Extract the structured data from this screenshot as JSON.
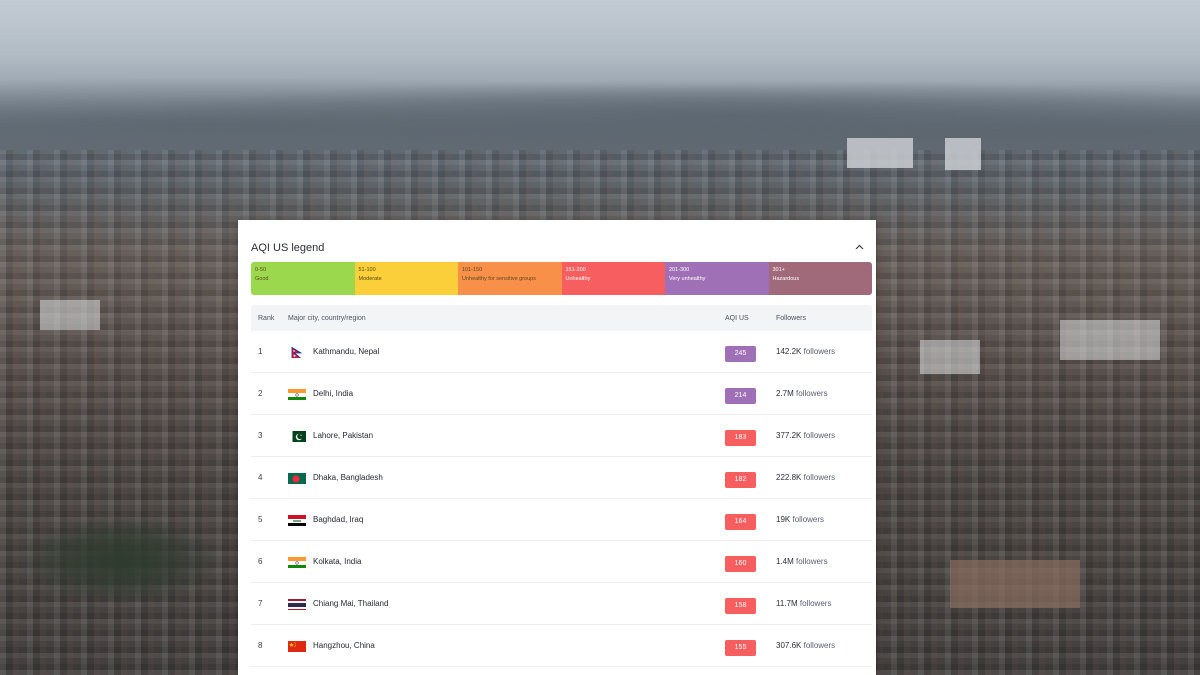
{
  "panel": {
    "title": "AQI US legend",
    "legend": [
      {
        "range": "0-50",
        "label": "Good",
        "color": "#9cd84e"
      },
      {
        "range": "51-100",
        "label": "Moderate",
        "color": "#facf39"
      },
      {
        "range": "101-150",
        "label": "Unhealthy for sensitive groups",
        "color": "#f99049"
      },
      {
        "range": "151-200",
        "label": "Unhealthy",
        "color": "#f65e5f"
      },
      {
        "range": "201-300",
        "label": "Very unhealthy",
        "color": "#a070b6"
      },
      {
        "range": "301+",
        "label": "Hazardous",
        "color": "#a06a7b"
      }
    ]
  },
  "table": {
    "headers": {
      "rank": "Rank",
      "city": "Major city, country/region",
      "aqi": "AQI US",
      "followers": "Followers"
    },
    "rows": [
      {
        "rank": "1",
        "city": "Kathmandu, Nepal",
        "flag": "nepal-flag",
        "aqi": "245",
        "aqi_color": "#a070b6",
        "followers": "142.2K",
        "followers_suffix": "followers"
      },
      {
        "rank": "2",
        "city": "Delhi, India",
        "flag": "india-flag",
        "aqi": "214",
        "aqi_color": "#a070b6",
        "followers": "2.7M",
        "followers_suffix": "followers"
      },
      {
        "rank": "3",
        "city": "Lahore, Pakistan",
        "flag": "pakistan-flag",
        "aqi": "183",
        "aqi_color": "#f65e5f",
        "followers": "377.2K",
        "followers_suffix": "followers"
      },
      {
        "rank": "4",
        "city": "Dhaka, Bangladesh",
        "flag": "bangladesh-flag",
        "aqi": "182",
        "aqi_color": "#f65e5f",
        "followers": "222.8K",
        "followers_suffix": "followers"
      },
      {
        "rank": "5",
        "city": "Baghdad, Iraq",
        "flag": "iraq-flag",
        "aqi": "164",
        "aqi_color": "#f65e5f",
        "followers": "19K",
        "followers_suffix": "followers"
      },
      {
        "rank": "6",
        "city": "Kolkata, India",
        "flag": "india-flag",
        "aqi": "160",
        "aqi_color": "#f65e5f",
        "followers": "1.4M",
        "followers_suffix": "followers"
      },
      {
        "rank": "7",
        "city": "Chiang Mai, Thailand",
        "flag": "thailand-flag",
        "aqi": "158",
        "aqi_color": "#f65e5f",
        "followers": "11.7M",
        "followers_suffix": "followers"
      },
      {
        "rank": "8",
        "city": "Hangzhou, China",
        "flag": "china-flag",
        "aqi": "155",
        "aqi_color": "#f65e5f",
        "followers": "307.6K",
        "followers_suffix": "followers"
      }
    ]
  }
}
